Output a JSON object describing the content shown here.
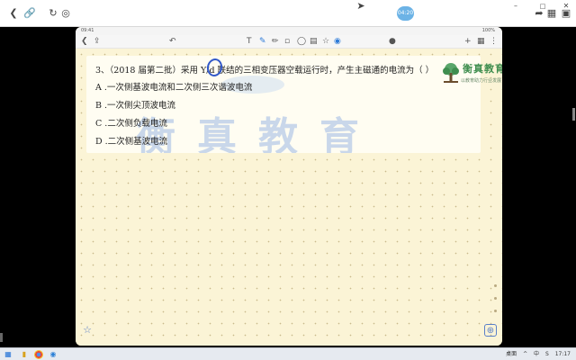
{
  "viewer_toolbar": {
    "timer_label": "04:20",
    "icons": [
      "back-icon",
      "link-icon",
      "refresh-icon",
      "globe-icon",
      "cursor-icon",
      "share-icon",
      "gift-icon",
      "pip-icon",
      "minimize-icon",
      "maximize-icon",
      "close-icon"
    ]
  },
  "tablet": {
    "status_time": "09:41",
    "status_battery": "100%",
    "app_toolbar_icons": [
      "back-icon",
      "share-icon",
      "undo-icon",
      "text-tool-icon",
      "pen-icon",
      "pencil-icon",
      "eraser-icon",
      "lasso-icon",
      "image-icon",
      "shape-icon",
      "marker-icon",
      "mic-icon",
      "add-page-icon",
      "pages-icon",
      "more-icon"
    ]
  },
  "question": {
    "stem": "3、（2018 届第二批）采用 Y/d 联结的三相变压器空载运行时，产生主磁通的电流为（     ）",
    "options": [
      {
        "letter": "A",
        "text": "一次侧基波电流和二次侧三次谐波电流"
      },
      {
        "letter": "B",
        "text": "一次侧尖顶波电流"
      },
      {
        "letter": "C",
        "text": "二次侧负载电流"
      },
      {
        "letter": "D",
        "text": "二次侧基波电流"
      }
    ]
  },
  "logo": {
    "brand": "衡真教育",
    "slogan": "以教育助力行业发展"
  },
  "taskbar": {
    "tray_items": [
      "桌面",
      "^",
      "中",
      "S"
    ],
    "time": "17:17"
  },
  "colors": {
    "page_bg": "#fbf4d6",
    "pen_ink": "#3158c9",
    "logo_green": "#3f8e4f",
    "timer_blue": "#6cb3e6"
  }
}
